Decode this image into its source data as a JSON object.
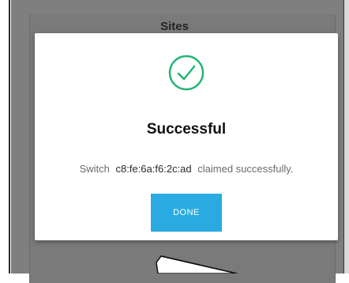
{
  "background": {
    "page_title": "Sites"
  },
  "dialog": {
    "icon": "check-circle-icon",
    "title": "Successful",
    "message_prefix": "Switch",
    "device_mac": "c8:fe:6a:f6:2c:ad",
    "message_suffix": "claimed successfully.",
    "done_label": "DONE"
  },
  "colors": {
    "accent": "#29abe2",
    "success": "#22b573",
    "overlay": "#7f7f7f"
  }
}
